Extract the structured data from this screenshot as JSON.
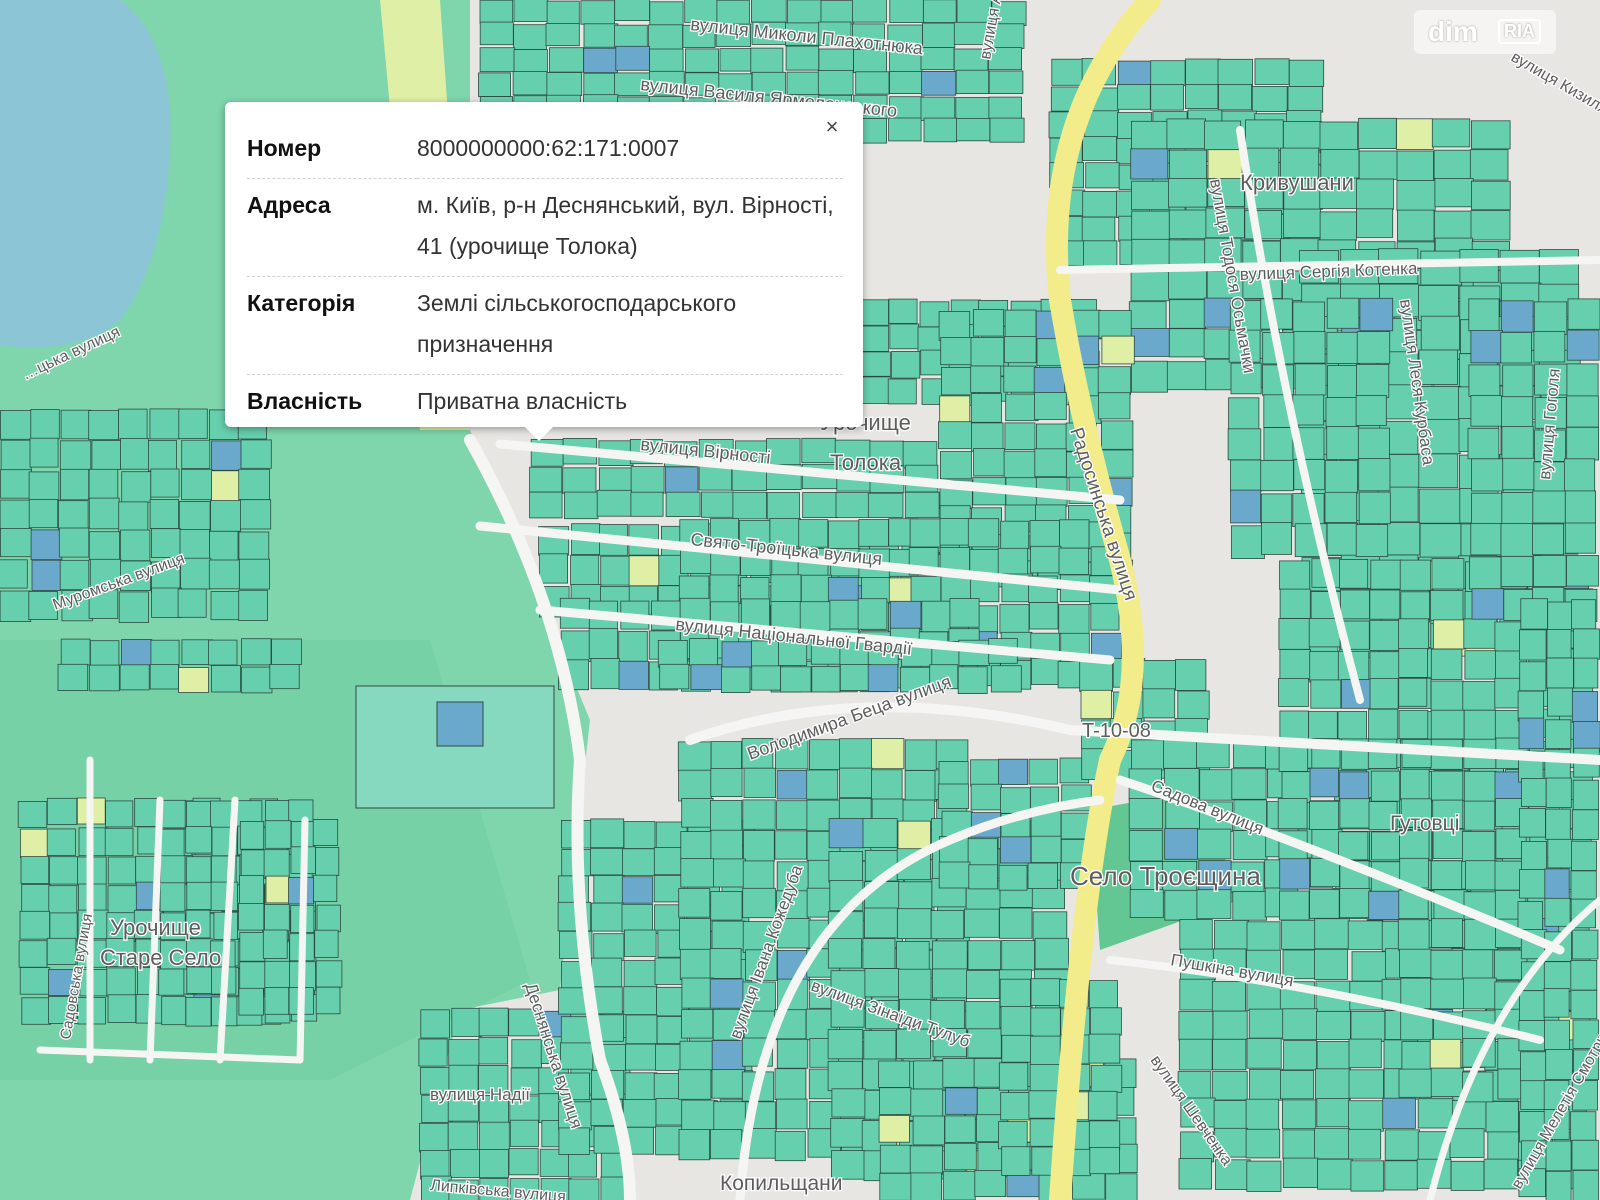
{
  "map": {
    "colors": {
      "water": "#8cc5d6",
      "forest": "#7fd6ad",
      "parcel": "#66d0ae",
      "parcel_blue": "#6aa9cc",
      "parcel_yellow": "#dff0a6",
      "road_bg": "#e8e6e3",
      "main_road": "#f3ec8a",
      "parcel_stroke": "#2d4a40"
    },
    "labels": [
      {
        "text": "вулиця Миколи Плахотнюка"
      },
      {
        "text": "вулиця Василя Ярмоленського"
      },
      {
        "text": "вулиця Андрія"
      },
      {
        "text": "Кривушани"
      },
      {
        "text": "вулиця Тодося Осьмачки"
      },
      {
        "text": "вулиця Сергія Котенка"
      },
      {
        "text": "вулиця Леся Курбаса"
      },
      {
        "text": "вулиця Гоголя"
      },
      {
        "text": "вулиця Кизиля"
      },
      {
        "text": "Урочище"
      },
      {
        "text": "Толока"
      },
      {
        "text": "вулиця Вірності"
      },
      {
        "text": "Свято-Троїцька вулиця"
      },
      {
        "text": "вулиця Національної Гвардії"
      },
      {
        "text": "Радосинська вулиця"
      },
      {
        "text": "Володимира Беца вулиця"
      },
      {
        "text": "T-10-08"
      },
      {
        "text": "Садова вулиця"
      },
      {
        "text": "Гутовці"
      },
      {
        "text": "Село Троєщина"
      },
      {
        "text": "вулиця Івана Кожедуба"
      },
      {
        "text": "вулиця Зінаїди Тулуб"
      },
      {
        "text": "Пушкіна вулиця"
      },
      {
        "text": "Деснянська вулиця"
      },
      {
        "text": "вулиця Надії"
      },
      {
        "text": "Липківська вулиця"
      },
      {
        "text": "Копильщани"
      },
      {
        "text": "вулиця Шевченка"
      },
      {
        "text": "вулиця Мелетія Смотрицького"
      },
      {
        "text": "Урочище"
      },
      {
        "text": "Старе Село"
      },
      {
        "text": "Cадовська вулиця"
      },
      {
        "text": "Муромська вулиця"
      },
      {
        "text": "…цька вулиця"
      }
    ]
  },
  "popup": {
    "close_label": "×",
    "rows": [
      {
        "key": "Номер",
        "value": "8000000000:62:171:0007"
      },
      {
        "key": "Адреса",
        "value": "м. Київ, р-н Деснянський, вул. Вірності, 41 (урочище Толока)"
      },
      {
        "key": "Категорія",
        "value": "Землі сільськогосподарського призначення"
      },
      {
        "key": "Власність",
        "value": "Приватна власність"
      }
    ]
  },
  "watermark": {
    "brand": "dim",
    "badge": "RIA"
  }
}
